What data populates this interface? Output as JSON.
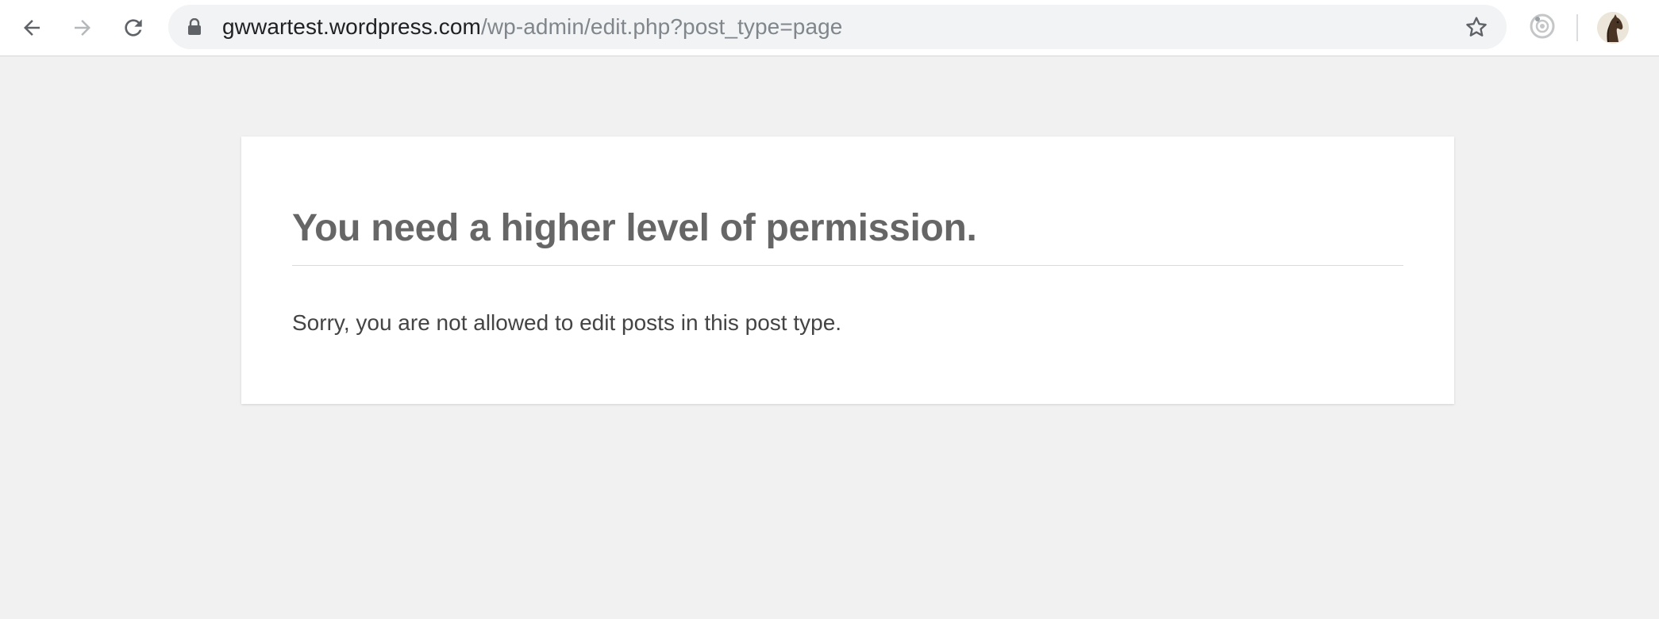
{
  "browser": {
    "url_host": "gwwartest.wordpress.com",
    "url_path": "/wp-admin/edit.php?post_type=page",
    "icons": {
      "back": "back-arrow-icon",
      "forward": "forward-arrow-icon",
      "reload": "reload-icon",
      "lock": "lock-icon",
      "bookmark": "star-icon",
      "extension": "extension-icon",
      "profile": "horse-avatar"
    }
  },
  "error_page": {
    "heading": "You need a higher level of permission.",
    "message": "Sorry, you are not allowed to edit posts in this post type."
  },
  "colors": {
    "page_background": "#f1f1f1",
    "card_background": "#ffffff",
    "heading": "#666666",
    "message": "#444444"
  }
}
